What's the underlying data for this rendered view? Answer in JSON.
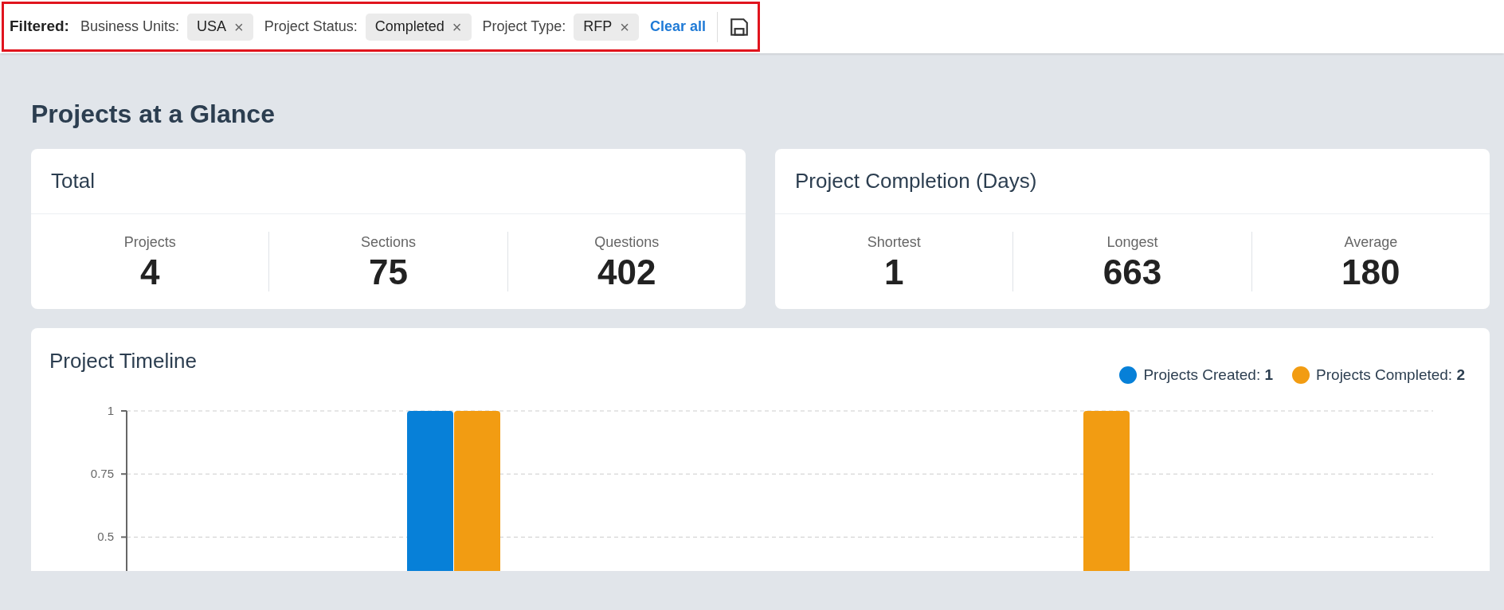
{
  "filter_bar": {
    "label": "Filtered:",
    "filters": [
      {
        "name": "Business Units:",
        "value": "USA",
        "remove": "×"
      },
      {
        "name": "Project Status:",
        "value": "Completed",
        "remove": "×"
      },
      {
        "name": "Project Type:",
        "value": "RFP",
        "remove": "×"
      }
    ],
    "clear_all": "Clear all"
  },
  "page_title": "Projects at a Glance",
  "cards": [
    {
      "title": "Total",
      "stats": [
        {
          "label": "Projects",
          "value": "4"
        },
        {
          "label": "Sections",
          "value": "75"
        },
        {
          "label": "Questions",
          "value": "402"
        }
      ]
    },
    {
      "title": "Project Completion (Days)",
      "stats": [
        {
          "label": "Shortest",
          "value": "1"
        },
        {
          "label": "Longest",
          "value": "663"
        },
        {
          "label": "Average",
          "value": "180"
        }
      ]
    }
  ],
  "timeline": {
    "title": "Project Timeline",
    "legend": [
      {
        "separator": ":",
        "count": "1"
      },
      {
        "separator": ":",
        "count": "2"
      }
    ],
    "chart_data": {
      "type": "bar",
      "categories": [
        null,
        null
      ],
      "series": [
        {
          "name": "Projects Created",
          "color": "#0780d8",
          "values": [
            1,
            null
          ]
        },
        {
          "name": "Projects Completed",
          "color": "#f29c12",
          "values": [
            1,
            1
          ]
        }
      ],
      "ylim": [
        0.35,
        1
      ],
      "yticks": [
        0.5,
        0.75,
        1
      ]
    }
  }
}
